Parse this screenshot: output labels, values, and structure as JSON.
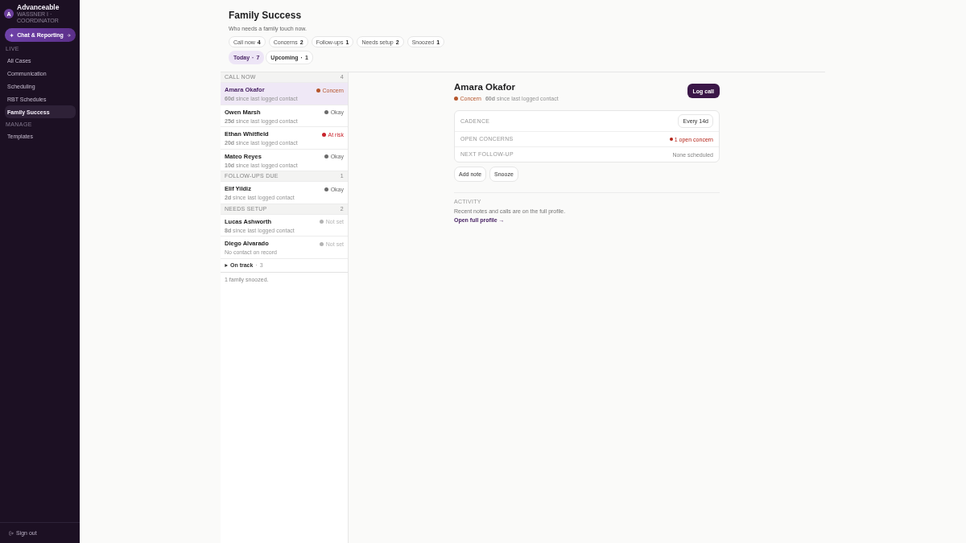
{
  "sidebar": {
    "brand": {
      "initial": "A",
      "name": "Advanceable",
      "subtitle": "WASSNER I · COORDINATOR"
    },
    "primary_action": {
      "label": "Chat & Reporting"
    },
    "sections": [
      {
        "label": "LIVE",
        "items": [
          {
            "label": "All Cases",
            "selected": false
          },
          {
            "label": "Communication",
            "selected": false
          },
          {
            "label": "Scheduling",
            "selected": false
          },
          {
            "label": "RBT Schedules",
            "selected": false
          },
          {
            "label": "Family Success",
            "selected": true
          }
        ]
      },
      {
        "label": "MANAGE",
        "items": [
          {
            "label": "Templates",
            "selected": false
          }
        ]
      }
    ],
    "footer": {
      "label": "Sign out"
    }
  },
  "header": {
    "title": "Family Success",
    "subtitle": "Who needs a family touch now."
  },
  "filters": [
    {
      "label": "Call now",
      "count": "4"
    },
    {
      "label": "Concerns",
      "count": "2"
    },
    {
      "label": "Follow-ups",
      "count": "1"
    },
    {
      "label": "Needs setup",
      "count": "2"
    },
    {
      "label": "Snoozed",
      "count": "1"
    }
  ],
  "tabs": [
    {
      "label": "Today",
      "separator": "·",
      "count": "7",
      "selected": true
    },
    {
      "label": "Upcoming",
      "separator": "·",
      "count": "1",
      "selected": false
    }
  ],
  "list": {
    "groups": [
      {
        "title": "CALL NOW",
        "count": "4",
        "rows": [
          {
            "name": "Amara Okafor",
            "status": "Concern",
            "color": "#b5552b",
            "contact": "**60d** since last logged contact",
            "selected": true
          },
          {
            "name": "Owen Marsh",
            "status": "Okay",
            "color": "#6b6b6b",
            "contact": "**25d** since last logged contact",
            "selected": false
          },
          {
            "name": "Ethan Whitfield",
            "status": "At risk",
            "color": "#c8232c",
            "contact": "**20d** since last logged contact",
            "selected": false
          },
          {
            "name": "Mateo Reyes",
            "status": "Okay",
            "color": "#6b6b6b",
            "contact": "**10d** since last logged contact",
            "selected": false
          }
        ]
      },
      {
        "title": "FOLLOW-UPS DUE",
        "count": "1",
        "rows": [
          {
            "name": "Elif Yildiz",
            "status": "Okay",
            "color": "#6b6b6b",
            "contact": "**2d** since last logged contact",
            "selected": false
          }
        ]
      },
      {
        "title": "NEEDS SETUP",
        "count": "2",
        "rows": [
          {
            "name": "Lucas Ashworth",
            "status": "Not set",
            "color": "#b3b3b3",
            "contact": "**8d** since last logged contact",
            "selected": false
          },
          {
            "name": "Diego Alvarado",
            "status": "Not set",
            "color": "#b3b3b3",
            "contact": "No contact on record",
            "selected": false
          }
        ]
      }
    ],
    "collapsed_group": {
      "title": "On track",
      "separator": "·",
      "count": "3",
      "expanded": false
    },
    "footnote": "1 family snoozed."
  },
  "detail": {
    "name": "Amara Okafor",
    "status": "Concern",
    "color": "#b5552b",
    "contact": "**60d** since last logged contact",
    "primary_button": "Log call",
    "fields": [
      {
        "label": "CADENCE",
        "kind": "button",
        "value": "Every 14d"
      },
      {
        "label": "OPEN CONCERNS",
        "kind": "alert",
        "value": "1 open concern"
      },
      {
        "label": "NEXT FOLLOW-UP",
        "kind": "text",
        "value": "None scheduled"
      }
    ],
    "actions": [
      "Add note",
      "Snooze"
    ],
    "activity": {
      "label": "ACTIVITY",
      "text": "Recent notes and calls are on the full profile.",
      "link": "Open full profile →"
    }
  }
}
